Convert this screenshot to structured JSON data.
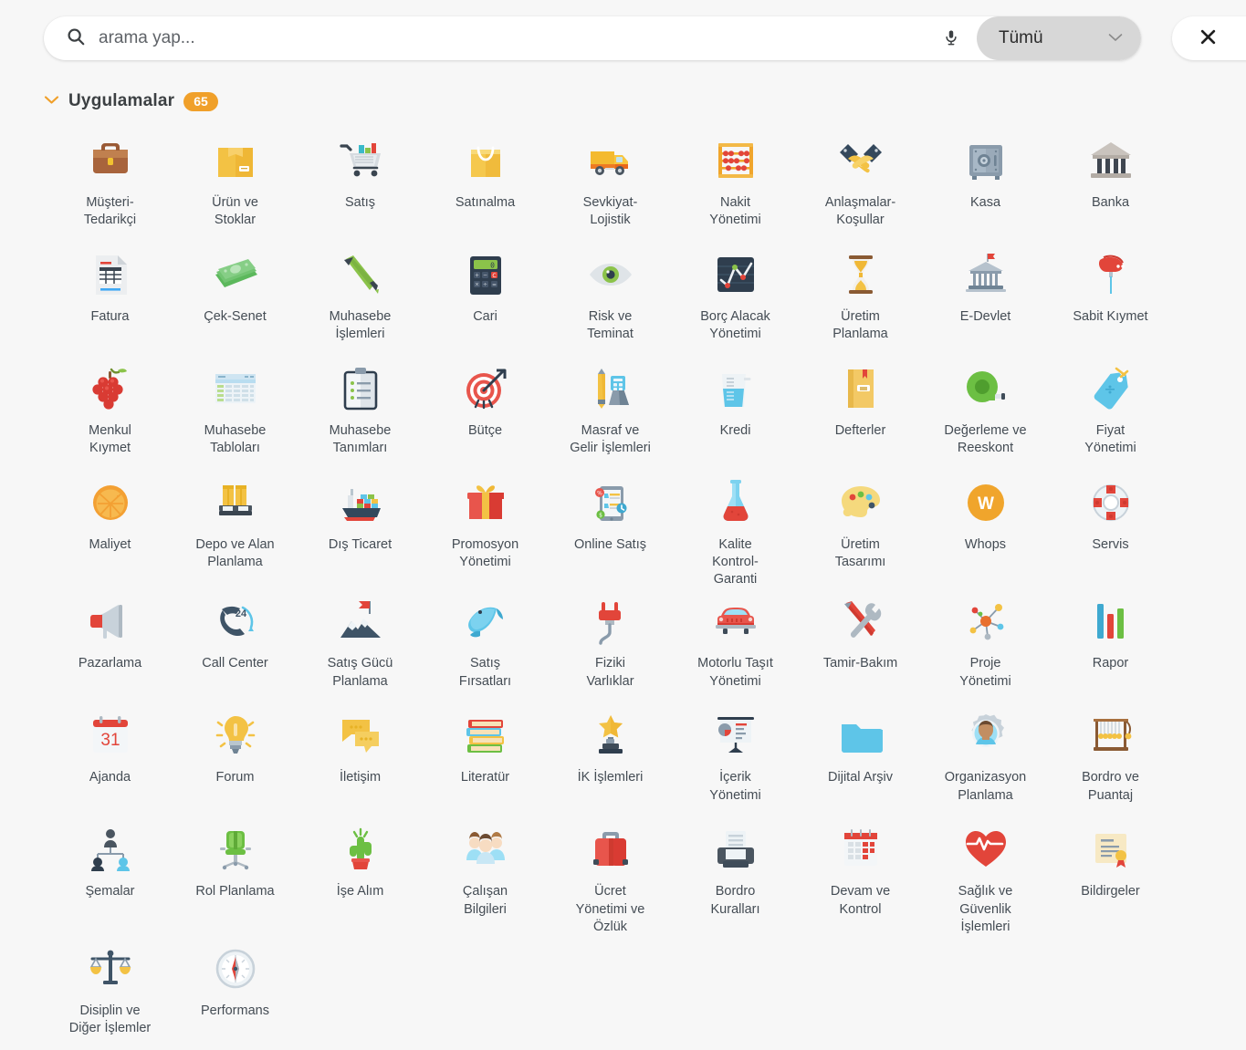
{
  "search": {
    "placeholder": "arama yap...",
    "value": "",
    "mic_icon": "microphone-icon",
    "search_icon": "search-icon",
    "scope_value": "Tümü",
    "scope_chevron_icon": "chevron-down-icon"
  },
  "close": {
    "icon": "close-icon",
    "label": ""
  },
  "section": {
    "caret_icon": "chevron-down-icon",
    "title": "Uygulamalar",
    "count": "65"
  },
  "colors": {
    "page_background": "#f7f7f7",
    "accent_orange": "#f0a02a",
    "scope_background": "#d7d7d7",
    "label_text": "#444c54",
    "search_text": "#3c4043"
  },
  "apps": [
    {
      "label": "Müşteri-\nTedarikçi",
      "icon": "briefcase-icon"
    },
    {
      "label": "Ürün ve\nStoklar",
      "icon": "package-box-icon"
    },
    {
      "label": "Satış",
      "icon": "shopping-cart-icon"
    },
    {
      "label": "Satınalma",
      "icon": "shopping-bag-icon"
    },
    {
      "label": "Sevkiyat-\nLojistik",
      "icon": "delivery-truck-icon"
    },
    {
      "label": "Nakit\nYönetimi",
      "icon": "abacus-icon"
    },
    {
      "label": "Anlaşmalar-\nKoşullar",
      "icon": "handshake-icon"
    },
    {
      "label": "Kasa",
      "icon": "safe-vault-icon"
    },
    {
      "label": "Banka",
      "icon": "bank-icon"
    },
    {
      "label": "Fatura",
      "icon": "invoice-document-icon"
    },
    {
      "label": "Çek-Senet",
      "icon": "banknotes-icon"
    },
    {
      "label": "Muhasebe\nİşlemleri",
      "icon": "pen-icon"
    },
    {
      "label": "Cari",
      "icon": "calculator-icon"
    },
    {
      "label": "Risk ve\nTeminat",
      "icon": "eye-icon"
    },
    {
      "label": "Borç Alacak\nYönetimi",
      "icon": "line-chart-icon"
    },
    {
      "label": "Üretim\nPlanlama",
      "icon": "hourglass-icon"
    },
    {
      "label": "E-Devlet",
      "icon": "government-building-icon"
    },
    {
      "label": "Sabit Kıymet",
      "icon": "stamp-icon"
    },
    {
      "label": "Menkul\nKıymet",
      "icon": "grapes-icon"
    },
    {
      "label": "Muhasebe\nTabloları",
      "icon": "spreadsheet-icon"
    },
    {
      "label": "Muhasebe\nTanımları",
      "icon": "clipboard-list-icon"
    },
    {
      "label": "Bütçe",
      "icon": "target-dart-icon"
    },
    {
      "label": "Masraf ve\nGelir İşlemleri",
      "icon": "pencil-ruler-icon"
    },
    {
      "label": "Kredi",
      "icon": "measuring-jug-icon"
    },
    {
      "label": "Defterler",
      "icon": "ledger-book-icon"
    },
    {
      "label": "Değerleme ve\nReeskont",
      "icon": "tape-measure-icon"
    },
    {
      "label": "Fiyat\nYönetimi",
      "icon": "price-tag-icon"
    },
    {
      "label": "Maliyet",
      "icon": "orange-slice-icon"
    },
    {
      "label": "Depo ve Alan\nPlanlama",
      "icon": "pallet-icon"
    },
    {
      "label": "Dış Ticaret",
      "icon": "cargo-ship-icon"
    },
    {
      "label": "Promosyon\nYönetimi",
      "icon": "gift-box-icon"
    },
    {
      "label": "Online Satış",
      "icon": "tablet-shopping-icon"
    },
    {
      "label": "Kalite\nKontrol-\nGaranti",
      "icon": "flask-icon"
    },
    {
      "label": "Üretim\nTasarımı",
      "icon": "paint-palette-icon"
    },
    {
      "label": "Whops",
      "icon": "whops-logo-icon"
    },
    {
      "label": "Servis",
      "icon": "lifebuoy-icon"
    },
    {
      "label": "Pazarlama",
      "icon": "megaphone-icon"
    },
    {
      "label": "Call Center",
      "icon": "phone-24-icon"
    },
    {
      "label": "Satış Gücü\nPlanlama",
      "icon": "mountain-flag-icon"
    },
    {
      "label": "Satış\nFırsatları",
      "icon": "fish-icon"
    },
    {
      "label": "Fiziki\nVarlıklar",
      "icon": "power-plug-icon"
    },
    {
      "label": "Motorlu Taşıt\nYönetimi",
      "icon": "car-icon"
    },
    {
      "label": "Tamir-Bakım",
      "icon": "wrench-screwdriver-icon"
    },
    {
      "label": "Proje\nYönetimi",
      "icon": "network-nodes-icon"
    },
    {
      "label": "Rapor",
      "icon": "bar-chart-icon"
    },
    {
      "label": "Ajanda",
      "icon": "calendar-31-icon"
    },
    {
      "label": "Forum",
      "icon": "lightbulb-icon"
    },
    {
      "label": "İletişim",
      "icon": "chat-bubbles-icon"
    },
    {
      "label": "Literatür",
      "icon": "books-stack-icon"
    },
    {
      "label": "İK İşlemleri",
      "icon": "trophy-star-icon"
    },
    {
      "label": "İçerik\nYönetimi",
      "icon": "presentation-chart-icon"
    },
    {
      "label": "Dijital Arşiv",
      "icon": "folder-icon"
    },
    {
      "label": "Organizasyon\nPlanlama",
      "icon": "person-gear-icon"
    },
    {
      "label": "Bordro ve\nPuantaj",
      "icon": "abacus-frame-icon"
    },
    {
      "label": "Şemalar",
      "icon": "org-chart-people-icon"
    },
    {
      "label": "Rol Planlama",
      "icon": "office-chair-icon"
    },
    {
      "label": "İşe Alım",
      "icon": "cactus-icon"
    },
    {
      "label": "Çalışan\nBilgileri",
      "icon": "employees-icon"
    },
    {
      "label": "Ücret\nYönetimi ve\nÖzlük",
      "icon": "suitcase-icon"
    },
    {
      "label": "Bordro\nKuralları",
      "icon": "printer-icon"
    },
    {
      "label": "Devam ve\nKontrol",
      "icon": "calendar-grid-icon"
    },
    {
      "label": "Sağlık ve\nGüvenlik\nİşlemleri",
      "icon": "heartbeat-icon"
    },
    {
      "label": "Bildirgeler",
      "icon": "certificate-icon"
    },
    {
      "label": "Disiplin ve\nDiğer İşlemler",
      "icon": "scales-justice-icon"
    },
    {
      "label": "Performans",
      "icon": "compass-icon"
    }
  ]
}
